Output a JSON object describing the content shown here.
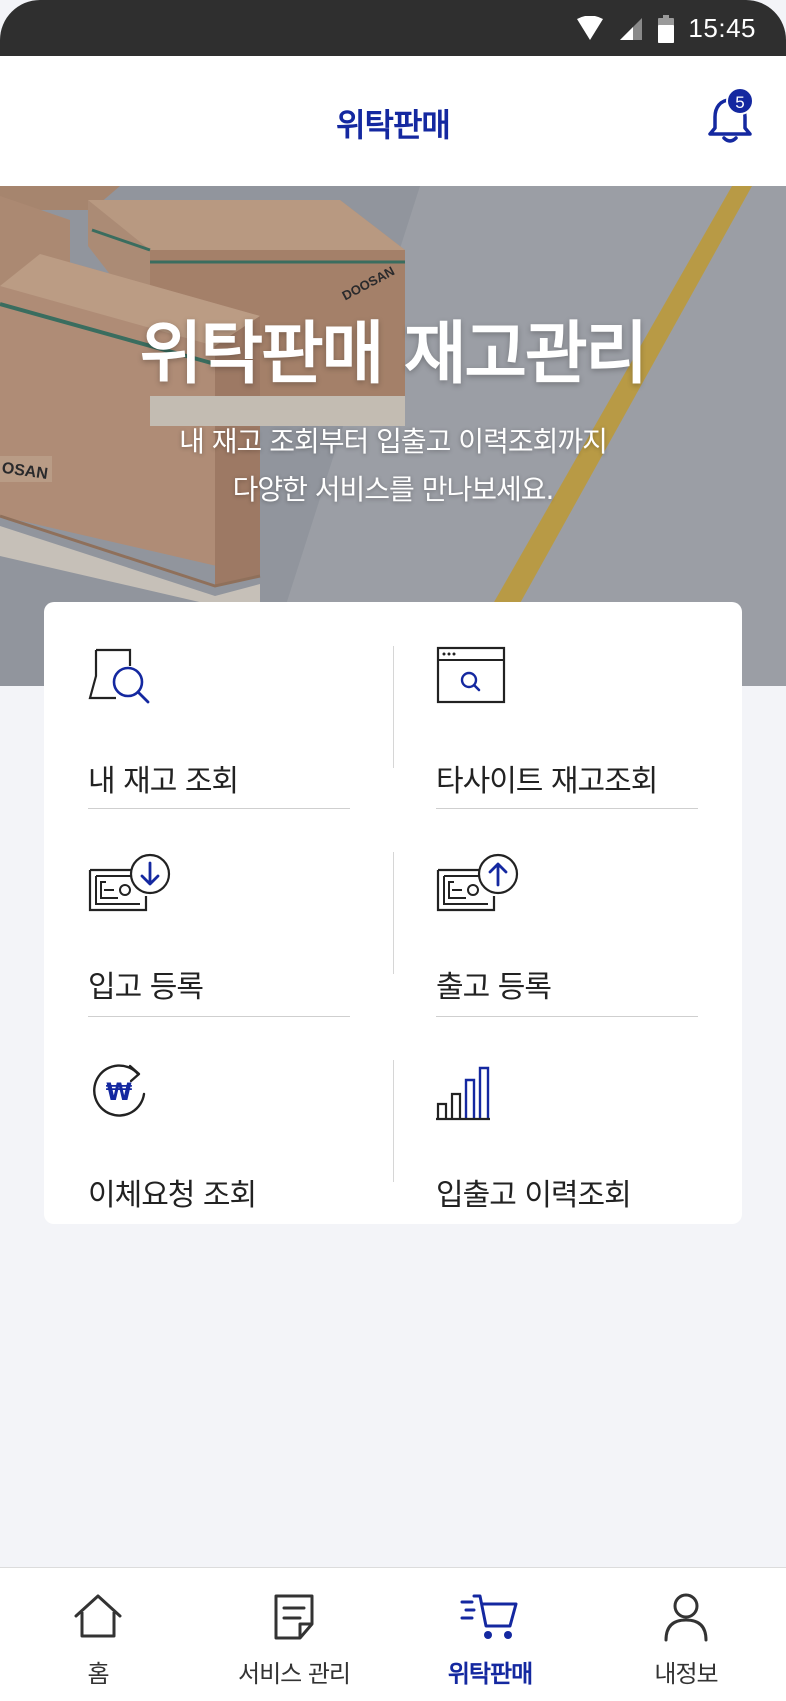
{
  "status_bar": {
    "time": "15:45",
    "icons": [
      "wifi-icon",
      "signal-icon",
      "battery-icon"
    ]
  },
  "header": {
    "title": "위탁판매",
    "notification_count": "5"
  },
  "hero": {
    "title": "위탁판매 재고관리",
    "subtitle_line1": "내 재고 조회부터 입출고 이력조회까지",
    "subtitle_line2": "다양한 서비스를 만나보세요."
  },
  "menu": {
    "items": [
      {
        "label": "내 재고 조회",
        "icon": "inventory-search-icon"
      },
      {
        "label": "타사이트 재고조회",
        "icon": "web-search-icon"
      },
      {
        "label": "입고 등록",
        "icon": "cash-in-icon"
      },
      {
        "label": "출고 등록",
        "icon": "cash-out-icon"
      },
      {
        "label": "이체요청 조회",
        "icon": "won-refresh-icon"
      },
      {
        "label": "입출고 이력조회",
        "icon": "bar-chart-icon"
      }
    ]
  },
  "nav": {
    "tabs": [
      {
        "label": "홈",
        "icon": "home-icon"
      },
      {
        "label": "서비스 관리",
        "icon": "document-icon"
      },
      {
        "label": "위탁판매",
        "icon": "cart-icon",
        "active": true
      },
      {
        "label": "내정보",
        "icon": "person-icon"
      }
    ]
  },
  "colors": {
    "accent": "#1428a0",
    "background": "#f3f4f8",
    "status_bar": "#2f2f2f"
  }
}
